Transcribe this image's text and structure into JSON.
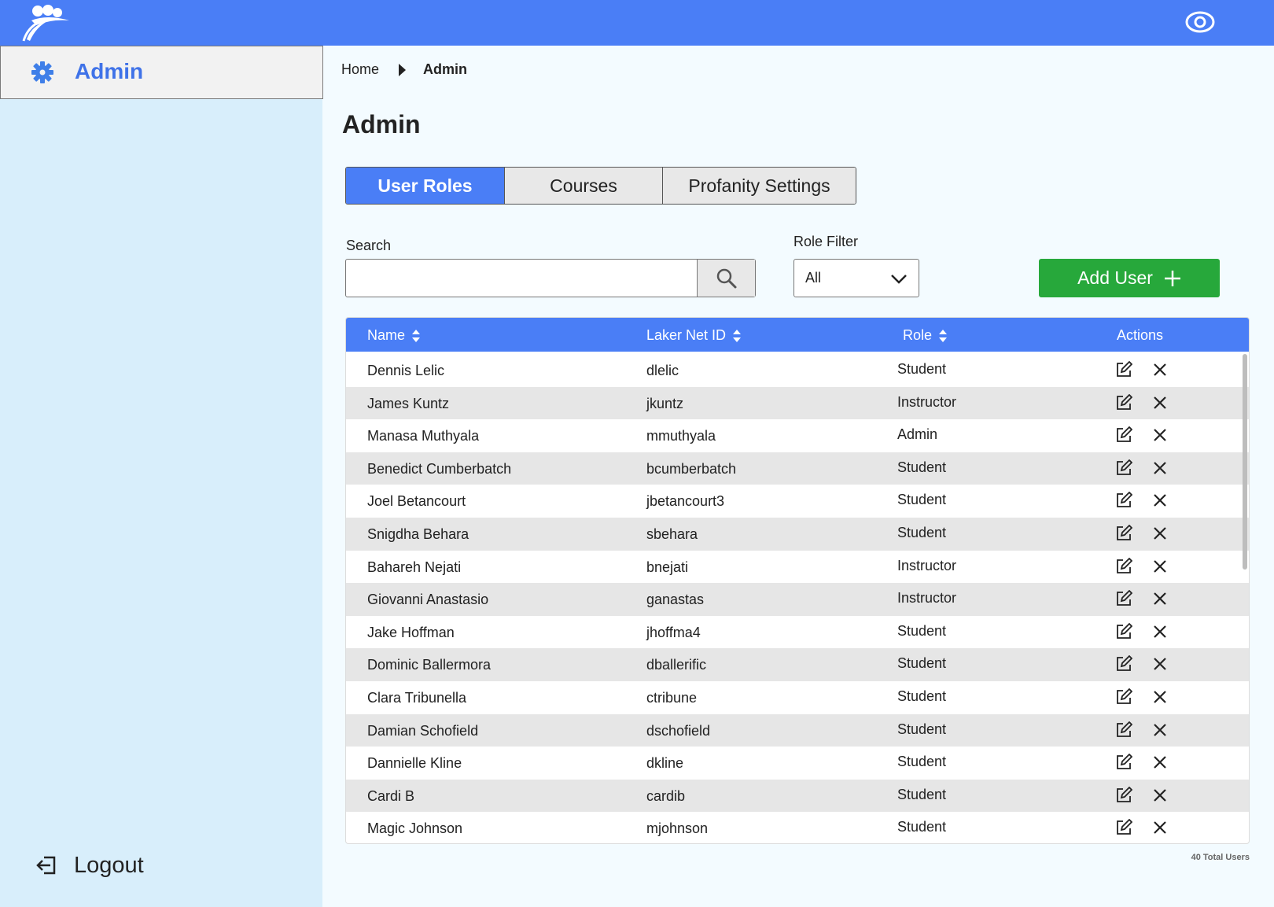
{
  "header": {
    "logo_icon": "people-logo-icon",
    "visibility_icon": "eye-icon",
    "color": "#4a7ef6"
  },
  "sidebar": {
    "title": "Admin",
    "title_icon": "gear-icon",
    "logout_label": "Logout",
    "logout_icon": "logout-icon"
  },
  "breadcrumb": {
    "home": "Home",
    "current": "Admin"
  },
  "page_title": "Admin",
  "tabs": [
    {
      "label": "User Roles",
      "active": true
    },
    {
      "label": "Courses",
      "active": false
    },
    {
      "label": "Profanity Settings",
      "active": false
    }
  ],
  "search": {
    "label": "Search",
    "value": "",
    "placeholder": ""
  },
  "role_filter": {
    "label": "Role Filter",
    "selected": "All"
  },
  "add_user": {
    "label": "Add User",
    "color": "#27a83b"
  },
  "table": {
    "columns": {
      "name": "Name",
      "netid": "Laker Net ID",
      "role": "Role",
      "actions": "Actions"
    },
    "rows": [
      {
        "name": "Dennis Lelic",
        "netid": "dlelic",
        "role": "Student"
      },
      {
        "name": "James Kuntz",
        "netid": "jkuntz",
        "role": "Instructor"
      },
      {
        "name": "Manasa Muthyala",
        "netid": "mmuthyala",
        "role": "Admin"
      },
      {
        "name": "Benedict Cumberbatch",
        "netid": "bcumberbatch",
        "role": "Student"
      },
      {
        "name": "Joel Betancourt",
        "netid": "jbetancourt3",
        "role": "Student"
      },
      {
        "name": "Snigdha Behara",
        "netid": "sbehara",
        "role": "Student"
      },
      {
        "name": "Bahareh Nejati",
        "netid": "bnejati",
        "role": "Instructor"
      },
      {
        "name": "Giovanni Anastasio",
        "netid": "ganastas",
        "role": "Instructor"
      },
      {
        "name": "Jake Hoffman",
        "netid": "jhoffma4",
        "role": "Student"
      },
      {
        "name": "Dominic Ballermora",
        "netid": "dballerific",
        "role": "Student"
      },
      {
        "name": "Clara Tribunella",
        "netid": "ctribune",
        "role": "Student"
      },
      {
        "name": "Damian Schofield",
        "netid": "dschofield",
        "role": "Student"
      },
      {
        "name": "Dannielle Kline",
        "netid": "dkline",
        "role": "Student"
      },
      {
        "name": "Cardi B",
        "netid": "cardib",
        "role": "Student"
      },
      {
        "name": "Magic Johnson",
        "netid": "mjohnson",
        "role": "Student"
      }
    ],
    "total_label": "40 Total Users"
  }
}
